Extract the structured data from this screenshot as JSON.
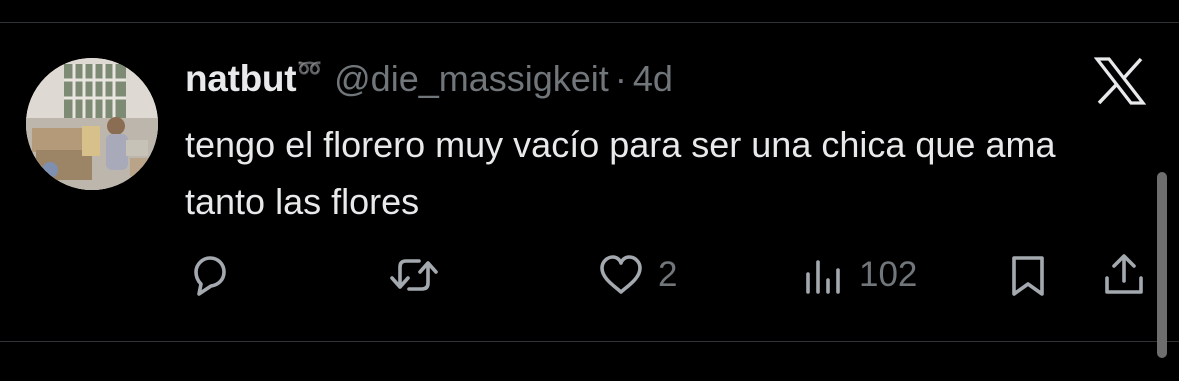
{
  "tweet": {
    "display_name": "natbut",
    "name_emoji": "➿",
    "handle": "@die_massigkeit",
    "separator": "·",
    "time": "4d",
    "text": "tengo el florero muy vacío para ser una chica que ama tanto las flores",
    "brand_icon": "x-logo-icon",
    "avatar_icon": "avatar-photo"
  },
  "actions": {
    "reply_icon": "reply-icon",
    "retweet_icon": "retweet-icon",
    "like_icon": "heart-icon",
    "like_count": "2",
    "views_icon": "views-chart-icon",
    "views_count": "102",
    "bookmark_icon": "bookmark-icon",
    "share_icon": "share-icon"
  },
  "colors": {
    "background": "#000000",
    "primary_text": "#e7e9ea",
    "secondary_text": "#71767b",
    "divider": "#2f3336"
  }
}
